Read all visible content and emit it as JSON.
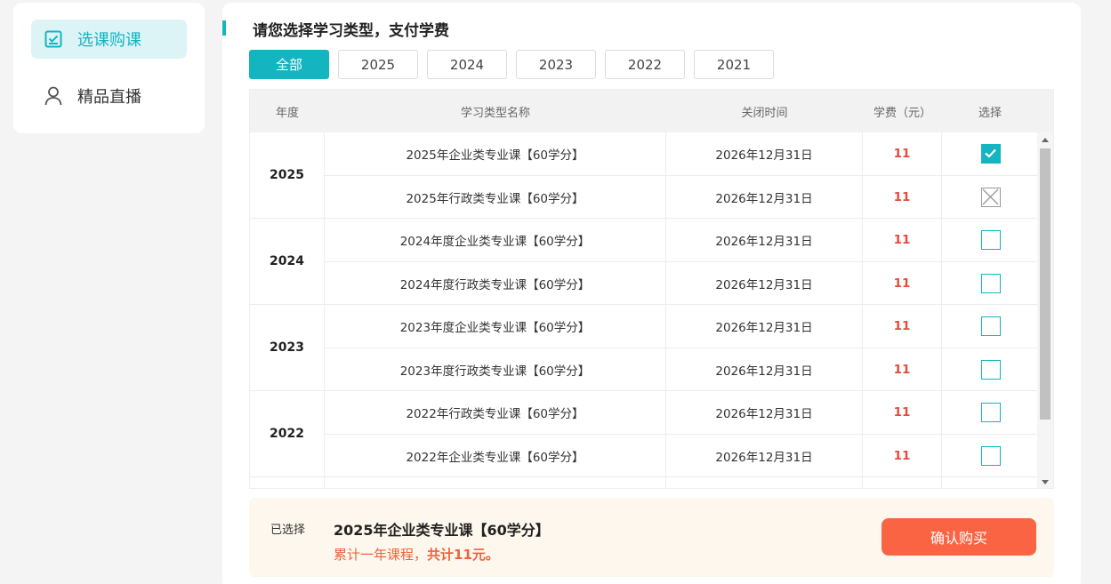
{
  "sidebar": {
    "items": [
      {
        "label": "选课购课",
        "icon": "checklist-icon",
        "active": true
      },
      {
        "label": "精品直播",
        "icon": "user-icon",
        "active": false
      }
    ]
  },
  "main": {
    "title": "请您选择学习类型，支付学费",
    "tabs": [
      "全部",
      "2025",
      "2024",
      "2023",
      "2022",
      "2021"
    ],
    "active_tab": "全部"
  },
  "table": {
    "headers": {
      "year": "年度",
      "name": "学习类型名称",
      "close": "关闭时间",
      "fee": "学费（元）",
      "select": "选择"
    },
    "groups": [
      {
        "year": "2025",
        "rows": [
          {
            "name": "2025年企业类专业课【60学分】",
            "close": "2026年12月31日",
            "fee": "11",
            "state": "checked"
          },
          {
            "name": "2025年行政类专业课【60学分】",
            "close": "2026年12月31日",
            "fee": "11",
            "state": "disabled"
          }
        ]
      },
      {
        "year": "2024",
        "rows": [
          {
            "name": "2024年度企业类专业课【60学分】",
            "close": "2026年12月31日",
            "fee": "11",
            "state": "unchecked"
          },
          {
            "name": "2024年度行政类专业课【60学分】",
            "close": "2026年12月31日",
            "fee": "11",
            "state": "unchecked"
          }
        ]
      },
      {
        "year": "2023",
        "rows": [
          {
            "name": "2023年度企业类专业课【60学分】",
            "close": "2026年12月31日",
            "fee": "11",
            "state": "unchecked"
          },
          {
            "name": "2023年度行政类专业课【60学分】",
            "close": "2026年12月31日",
            "fee": "11",
            "state": "unchecked"
          }
        ]
      },
      {
        "year": "2022",
        "rows": [
          {
            "name": "2022年行政类专业课【60学分】",
            "close": "2026年12月31日",
            "fee": "11",
            "state": "unchecked"
          },
          {
            "name": "2022年企业类专业课【60学分】",
            "close": "2026年12月31日",
            "fee": "11",
            "state": "unchecked"
          }
        ]
      },
      {
        "year": "",
        "rows": [
          {
            "name": "",
            "close": "",
            "fee": "",
            "state": "unchecked"
          }
        ]
      }
    ]
  },
  "summary": {
    "label": "已选择",
    "course": "2025年企业类专业课【60学分】",
    "note_prefix": "累计一年课程，",
    "note_total": "共计11元。",
    "buy_label": "确认购买"
  },
  "colors": {
    "accent": "#13b5c1",
    "fee": "#e64a3b",
    "buy_button": "#fb6443"
  }
}
